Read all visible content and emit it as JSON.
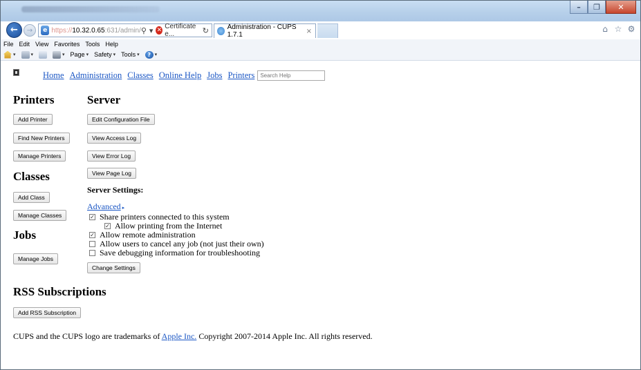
{
  "browser": {
    "address": {
      "scheme": "https://",
      "host": "10.32.0.65",
      "path": ":631/admin/",
      "search_glyph": "⚲",
      "dropdown_glyph": "▾",
      "cert_error_label": "Certificate e...",
      "refresh_glyph": "↻"
    },
    "tab": {
      "title": "Administration - CUPS 1.7.1",
      "close_glyph": "×"
    },
    "window_controls": {
      "minimize": "–",
      "restore": "❐",
      "close": "✕"
    },
    "menu": [
      "File",
      "Edit",
      "View",
      "Favorites",
      "Tools",
      "Help"
    ],
    "command_bar": {
      "page": "Page",
      "safety": "Safety",
      "tools": "Tools"
    }
  },
  "cups": {
    "nav": {
      "home": "Home",
      "administration": "Administration",
      "classes": "Classes",
      "online_help": "Online Help",
      "jobs": "Jobs",
      "printers": "Printers",
      "search_placeholder": "Search Help"
    },
    "printers": {
      "heading": "Printers",
      "add": "Add Printer",
      "find_new": "Find New Printers",
      "manage": "Manage Printers"
    },
    "classes": {
      "heading": "Classes",
      "add": "Add Class",
      "manage": "Manage Classes"
    },
    "jobs": {
      "heading": "Jobs",
      "manage": "Manage Jobs"
    },
    "server": {
      "heading": "Server",
      "edit_config": "Edit Configuration File",
      "view_access_log": "View Access Log",
      "view_error_log": "View Error Log",
      "view_page_log": "View Page Log",
      "settings_label": "Server Settings:",
      "advanced": "Advanced",
      "options": [
        {
          "label": "Share printers connected to this system",
          "checked": true
        },
        {
          "label": "Allow printing from the Internet",
          "checked": true
        },
        {
          "label": "Allow remote administration",
          "checked": true
        },
        {
          "label": "Allow users to cancel any job (not just their own)",
          "checked": false
        },
        {
          "label": "Save debugging information for troubleshooting",
          "checked": false
        }
      ],
      "change_settings": "Change Settings"
    },
    "rss": {
      "heading": "RSS Subscriptions",
      "add": "Add RSS Subscription"
    },
    "footer": {
      "prefix": "CUPS and the CUPS logo are trademarks of",
      "link": "Apple Inc.",
      "suffix": "Copyright 2007-2014 Apple Inc. All rights reserved."
    }
  }
}
